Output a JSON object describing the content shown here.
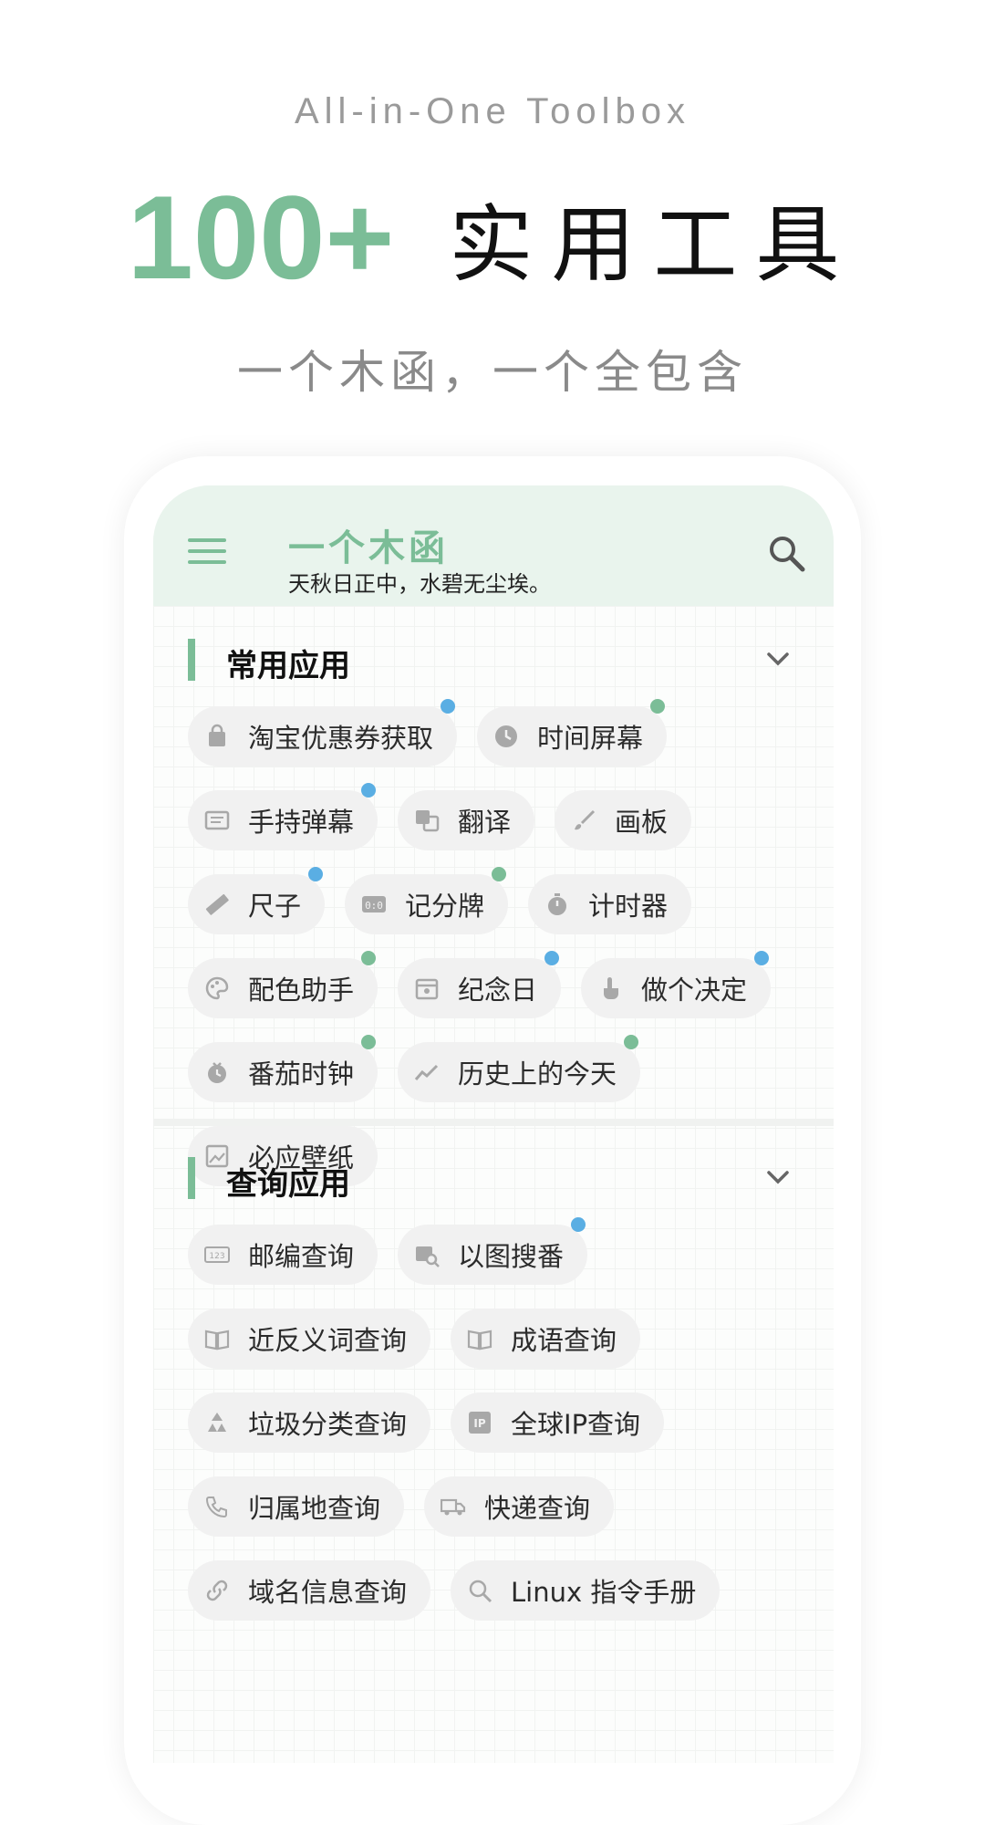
{
  "promo": {
    "tagline_en": "All-in-One Toolbox",
    "count": "100+",
    "title": "实用工具",
    "tagline_cn": "一个木函，一个全包含"
  },
  "appbar": {
    "title": "一个木函",
    "subtitle": "天秋日正中，水碧无尘埃。"
  },
  "colors": {
    "accent": "#7bbd97",
    "badge_blue": "#5aaee3",
    "badge_green": "#7bbd97"
  },
  "sections": [
    {
      "title": "常用应用",
      "rows": [
        [
          {
            "label": "淘宝优惠券获取",
            "icon": "shopping-bag-icon",
            "badge": "blue"
          },
          {
            "label": "时间屏幕",
            "icon": "clock-icon",
            "badge": "green"
          }
        ],
        [
          {
            "label": "手持弹幕",
            "icon": "marquee-icon",
            "badge": "blue"
          },
          {
            "label": "翻译",
            "icon": "translate-icon",
            "badge": ""
          },
          {
            "label": "画板",
            "icon": "brush-icon",
            "badge": ""
          }
        ],
        [
          {
            "label": "尺子",
            "icon": "ruler-icon",
            "badge": "blue"
          },
          {
            "label": "记分牌",
            "icon": "scoreboard-icon",
            "badge": "green"
          },
          {
            "label": "计时器",
            "icon": "timer-icon",
            "badge": ""
          }
        ],
        [
          {
            "label": "配色助手",
            "icon": "palette-icon",
            "badge": "green"
          },
          {
            "label": "纪念日",
            "icon": "calendar-icon",
            "badge": "blue"
          },
          {
            "label": "做个决定",
            "icon": "tap-icon",
            "badge": "blue"
          }
        ],
        [
          {
            "label": "番茄时钟",
            "icon": "pomodoro-icon",
            "badge": "green"
          },
          {
            "label": "历史上的今天",
            "icon": "trend-icon",
            "badge": "green"
          }
        ],
        [
          {
            "label": "必应壁纸",
            "icon": "image-icon",
            "badge": ""
          }
        ]
      ]
    },
    {
      "title": "查询应用",
      "rows": [
        [
          {
            "label": "邮编查询",
            "icon": "postcode-icon",
            "badge": ""
          },
          {
            "label": "以图搜番",
            "icon": "image-search-icon",
            "badge": "blue"
          }
        ],
        [
          {
            "label": "近反义词查询",
            "icon": "book-icon",
            "badge": ""
          },
          {
            "label": "成语查询",
            "icon": "book-icon",
            "badge": ""
          }
        ],
        [
          {
            "label": "垃圾分类查询",
            "icon": "recycle-icon",
            "badge": ""
          },
          {
            "label": "全球IP查询",
            "icon": "ip-icon",
            "badge": ""
          }
        ],
        [
          {
            "label": "归属地查询",
            "icon": "phone-icon",
            "badge": ""
          },
          {
            "label": "快递查询",
            "icon": "truck-icon",
            "badge": ""
          }
        ],
        [
          {
            "label": "域名信息查询",
            "icon": "link-icon",
            "badge": ""
          },
          {
            "label": "Linux 指令手册",
            "icon": "search-icon",
            "badge": ""
          }
        ]
      ]
    }
  ]
}
